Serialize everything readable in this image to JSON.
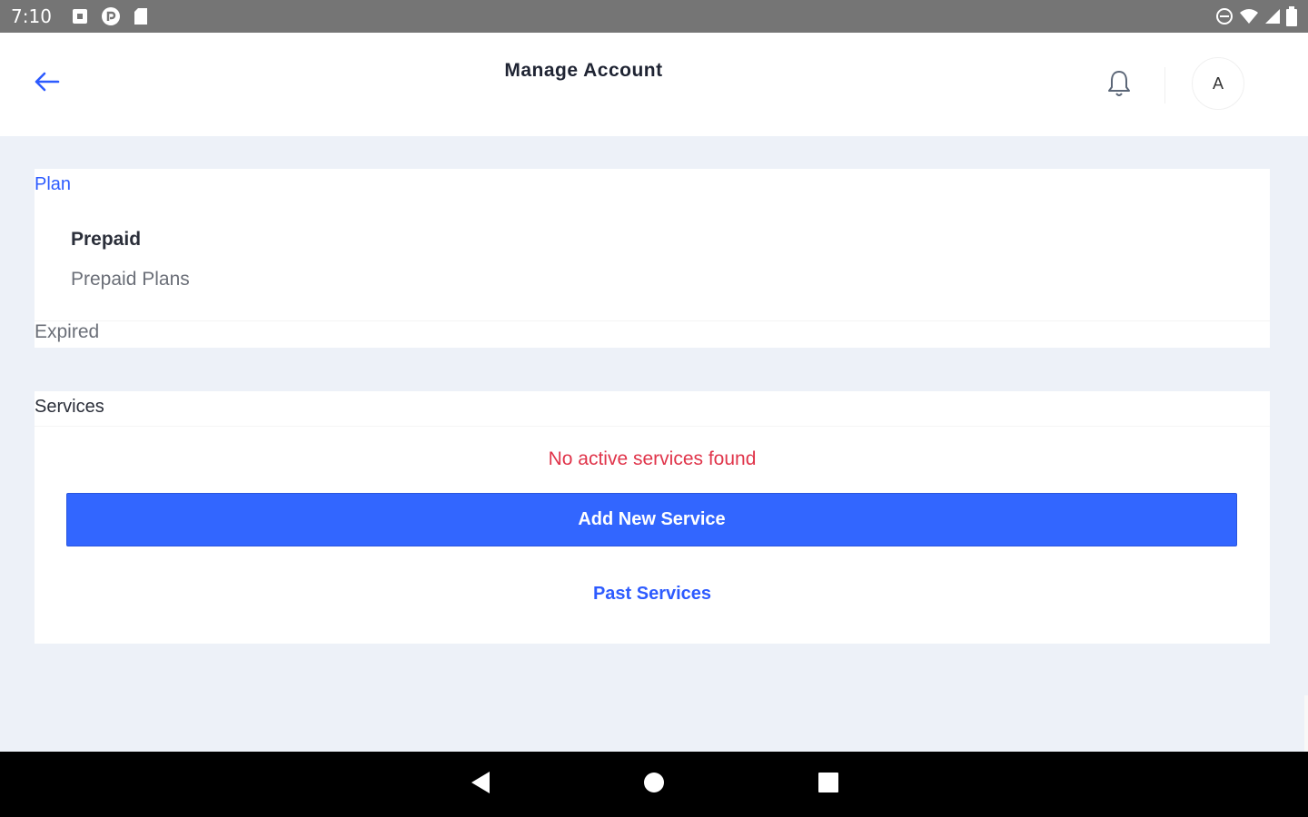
{
  "status_bar": {
    "time": "7:10",
    "left_icons": [
      "notification-icon",
      "pocket-casts-icon",
      "sd-card-icon"
    ],
    "right_icons": [
      "do-not-disturb-icon",
      "wifi-icon",
      "signal-icon",
      "battery-icon"
    ]
  },
  "header": {
    "title": "Manage Account",
    "back_icon": "arrow-left-icon",
    "notification_icon": "bell-icon",
    "avatar_initial": "A"
  },
  "plan_card": {
    "heading": "Plan",
    "plan_name": "Prepaid",
    "plan_description": "Prepaid Plans",
    "status": "Expired"
  },
  "services_card": {
    "heading": "Services",
    "empty_message": "No active services found",
    "add_button_label": "Add New Service",
    "past_services_label": "Past Services"
  },
  "nav_bar": {
    "icons": [
      "back-triangle-icon",
      "home-circle-icon",
      "recents-square-icon"
    ]
  },
  "colors": {
    "accent": "#3266ff",
    "link": "#2d5bff",
    "error": "#e0344a",
    "page_background": "#edf1f8",
    "status_bar": "#757575"
  }
}
